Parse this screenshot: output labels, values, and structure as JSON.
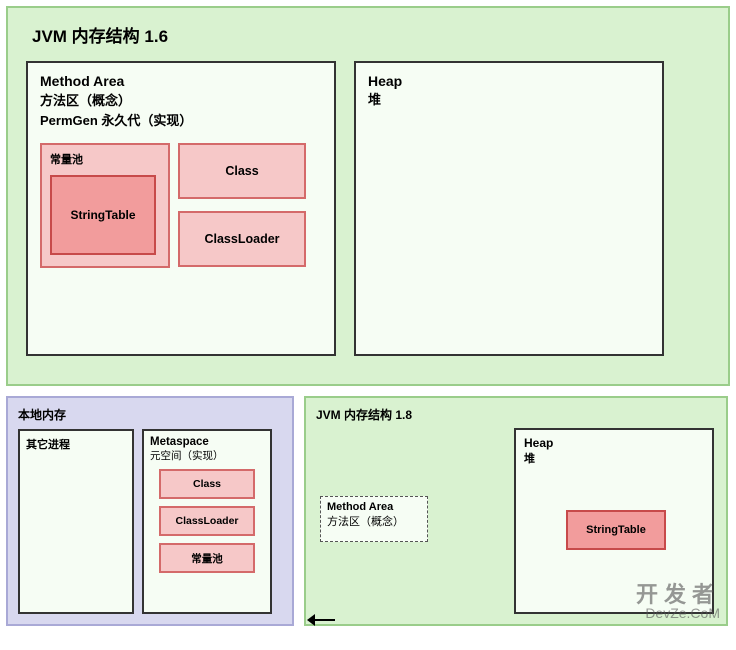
{
  "top": {
    "title": "JVM 内存结构 1.6",
    "methodArea": {
      "title": "Method Area",
      "sub1": "方法区（概念）",
      "sub2": "PermGen 永久代（实现）",
      "constPoolLabel": "常量池",
      "stringTable": "StringTable",
      "classBox": "Class",
      "classLoaderBox": "ClassLoader"
    },
    "heap": {
      "title": "Heap",
      "sub": "堆"
    }
  },
  "bottom": {
    "localMem": {
      "title": "本地内存",
      "otherProcTitle": "其它进程",
      "metaspace": {
        "title": "Metaspace",
        "sub": "元空间（实现）",
        "classBox": "Class",
        "classLoaderBox": "ClassLoader",
        "constPoolBox": "常量池"
      }
    },
    "jvm18": {
      "title": "JVM 内存结构 1.8",
      "methodArea": {
        "line1": "Method Area",
        "line2": "方法区（概念）"
      },
      "heap": {
        "title": "Heap",
        "sub": "堆",
        "stringTable": "StringTable"
      }
    }
  },
  "watermark": {
    "line1": "开发者",
    "line2": "DevZe.CoM"
  }
}
